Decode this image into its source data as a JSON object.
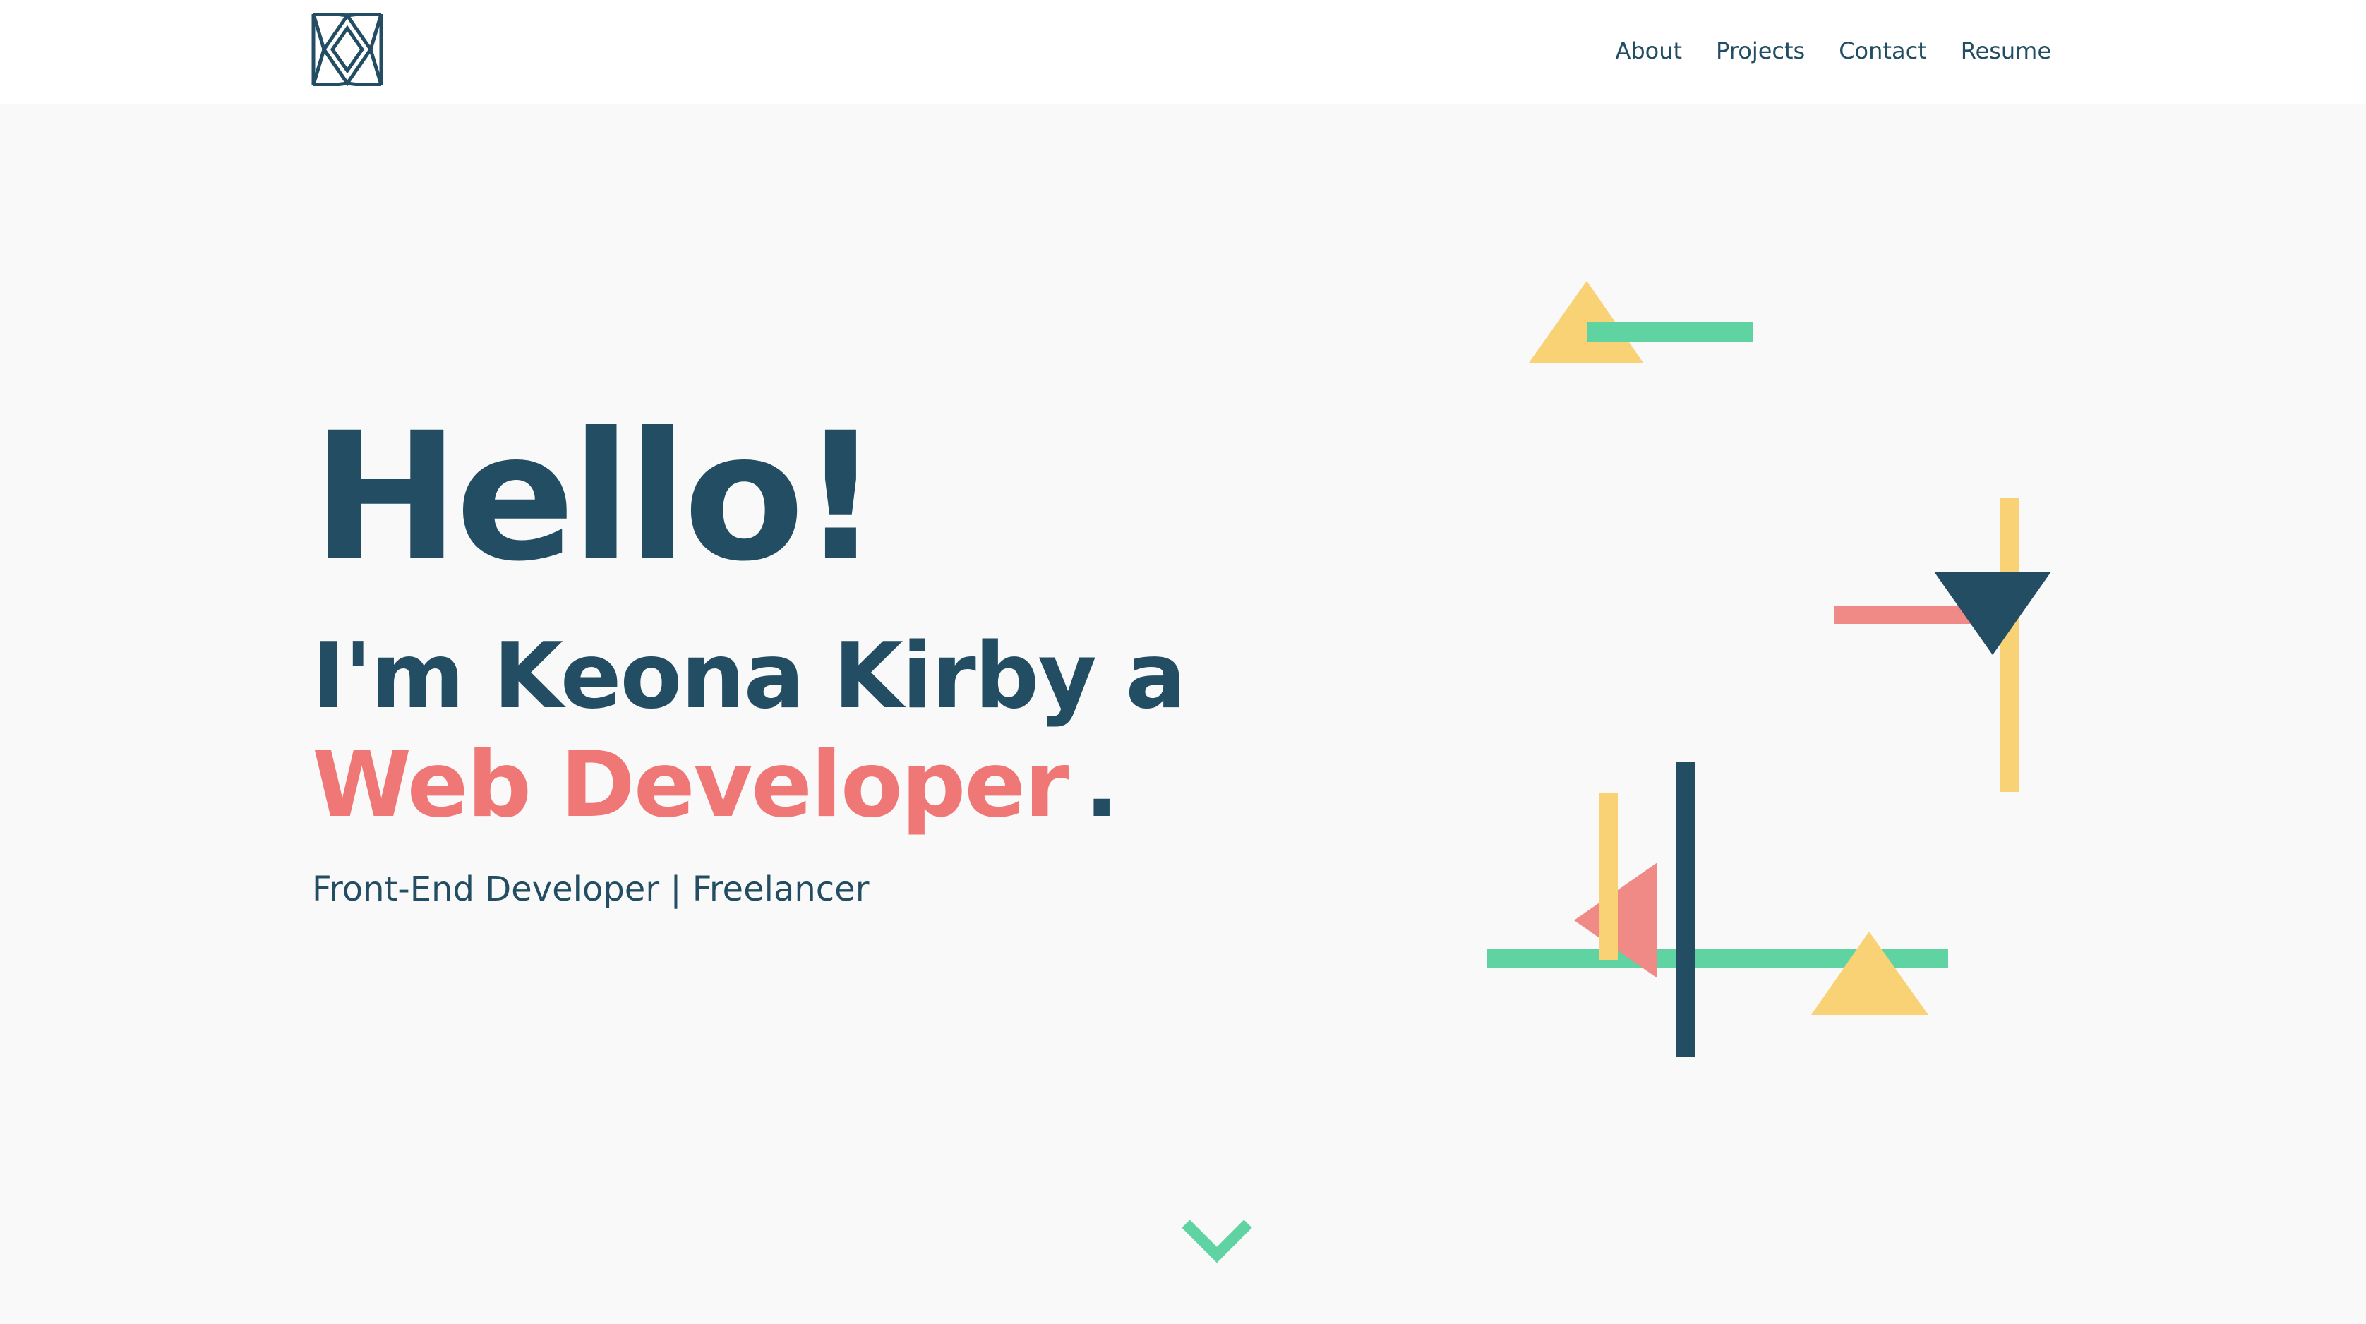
{
  "nav": {
    "items": [
      "About",
      "Projects",
      "Contact",
      "Resume"
    ]
  },
  "hero": {
    "greeting": "Hello!",
    "intro": "I'm Keona Kirby a",
    "role": "Web Developer",
    "role_suffix": ".",
    "tagline": "Front-End Developer | Freelancer"
  },
  "colors": {
    "navy": "#234d63",
    "coral": "#ef7775",
    "green": "#5fd4a2",
    "yellow": "#f8d275",
    "background": "#f9f9f9"
  },
  "icons": {
    "logo": "monogram-logo-icon",
    "scroll": "chevron-down-icon"
  }
}
